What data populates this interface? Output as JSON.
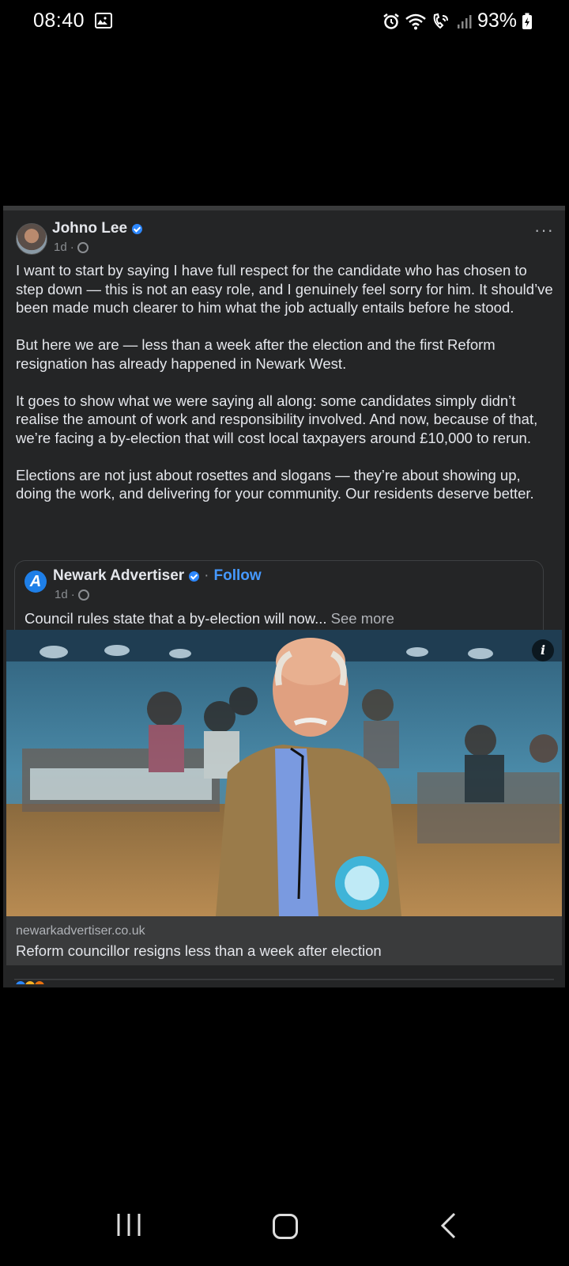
{
  "status_bar": {
    "time": "08:40",
    "battery": "93%"
  },
  "post": {
    "author": "Johno Lee",
    "time": "1d",
    "more": "···",
    "paragraphs": [
      "I want to start by saying I have full respect for the candidate who has chosen to step down — this is not an easy role, and I genuinely feel sorry for him. It should’ve been made much clearer to him what the job actually entails before he stood.",
      "But here we are — less than a week after the election and the first Reform resignation has already happened in Newark West.",
      "It goes to show what we were saying all along: some candidates simply didn’t realise the amount of work and responsibility involved. And now, because of that, we’re facing a by-election that will cost local taxpayers around £10,000 to rerun.",
      "Elections are not just about rosettes and slogans — they’re about showing up, doing the work, and delivering for your community. Our residents deserve better."
    ]
  },
  "shared": {
    "avatar_letter": "A",
    "page_name": "Newark Advertiser",
    "separator": "·",
    "follow_label": "Follow",
    "time": "1d",
    "text": "Council rules state that a by-election will now...",
    "see_more": "See more"
  },
  "link": {
    "info_label": "i",
    "domain": "newarkadvertiser.co.uk",
    "title": "Reform councillor resigns less than a week after election"
  },
  "colors": {
    "background": "#000000",
    "card": "#242526",
    "link_blue": "#4599ff",
    "verified_blue": "#2d88ff"
  }
}
